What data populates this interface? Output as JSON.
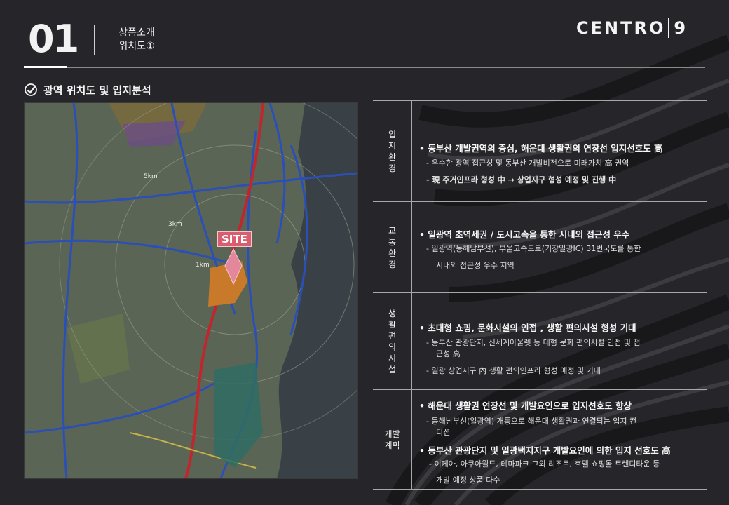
{
  "header": {
    "page_number": "01",
    "section_line1": "상품소개",
    "section_line2": "위치도①",
    "brand_main": "CENTRO",
    "brand_num": "9"
  },
  "subtitle": "광역 위치도 및 입지분석",
  "map": {
    "site_label": "SITE",
    "labels": [
      "5km",
      "3km",
      "1km"
    ]
  },
  "rows": [
    {
      "head": "입지환경",
      "bullets": [
        {
          "title": "• 동부산 개발권역의 중심, 해운대 생활권의 연장선 입지선호도 高",
          "subs": [
            "- 우수한 광역 접근성 및 동부산 개발비전으로 미래가치 高 권역",
            "- 現 주거인프라 형성 中 → 상업지구 형성 예정 및 진행 中"
          ]
        }
      ]
    },
    {
      "head": "교통환경",
      "bullets": [
        {
          "title": "• 일광역 초역세권 / 도시고속을 통한 시내외 접근성 우수",
          "subs": [
            "- 일광역(동해남부선), 부울고속도로(기장일광IC) 31번국도를 통한",
            "시내외 접근성 우수 지역"
          ]
        }
      ]
    },
    {
      "head": "생활편의시설",
      "bullets": [
        {
          "title": "• 초대형 쇼핑, 문화시설의 인접 , 생활 편의시설 형성 기대",
          "subs": [
            "- 동부산 관광단지, 신세계아울렛 등 대형 문화 편의시설 인접 및 접",
            "근성 高",
            "- 일광 상업지구 內 생활 편의인프라 형성 예정 및 기대"
          ]
        }
      ]
    },
    {
      "head": "개발계획",
      "bullets": [
        {
          "title": "• 해운대 생활권 연장선 및 개발요인으로 입지선호도 향상",
          "subs": [
            "- 동해남부선(일광역) 개통으로 해운대 생활권과 연결되는 입지 컨",
            "디션"
          ]
        },
        {
          "title": "• 동부산 관광단지 및 일광택지지구 개발요인에 의한 입지 선호도 高",
          "subs": [
            "- 이케아, 아쿠아월드, 테마파크 그외 리조트, 호텔 쇼핑몰 트렌디타운 등",
            "개발 예정 상품 다수"
          ]
        }
      ]
    }
  ],
  "colors": {
    "background": "#26262a",
    "site_badge": "#d85d6e",
    "site_area": "#c87a2a",
    "rail": "#c0262b",
    "road": "#2a4fb8"
  }
}
